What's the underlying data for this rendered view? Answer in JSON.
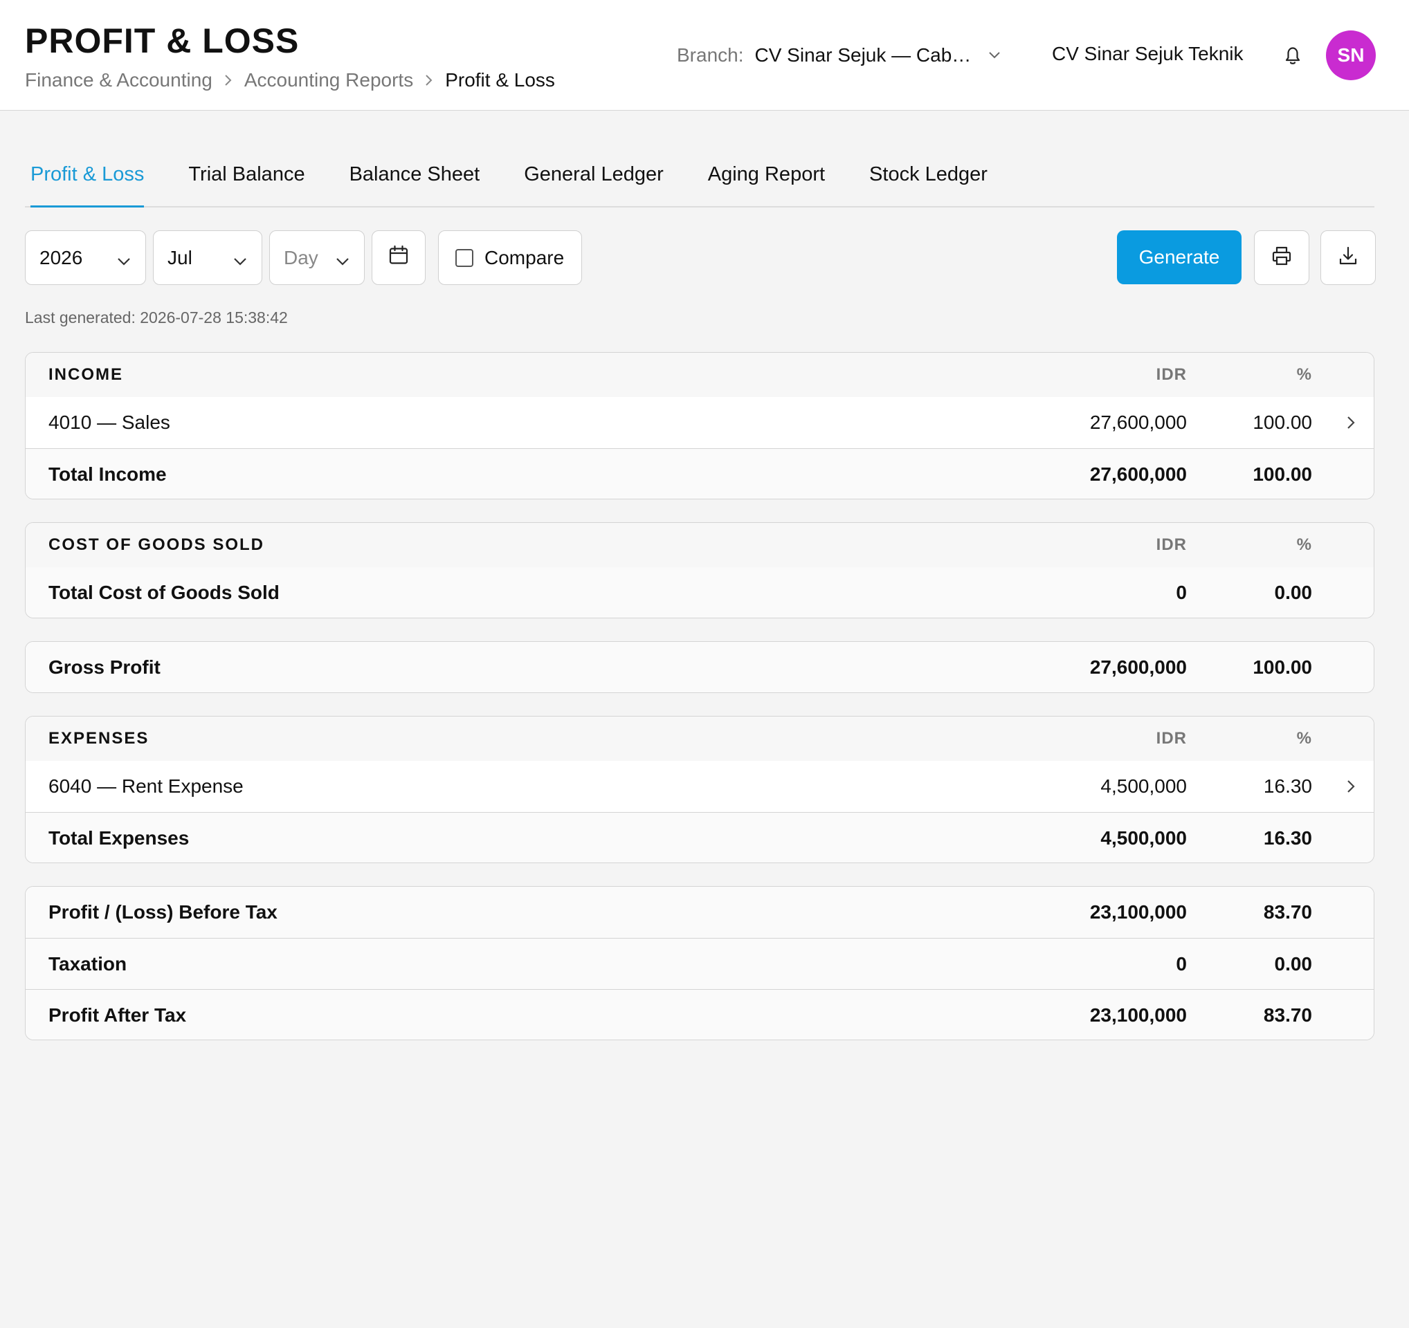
{
  "header": {
    "title": "PROFIT & LOSS",
    "breadcrumb": [
      "Finance & Accounting",
      "Accounting Reports",
      "Profit & Loss"
    ],
    "branch_label": "Branch:",
    "branch_value": "CV Sinar Sejuk — Cab…",
    "company": "CV Sinar Sejuk Teknik",
    "avatar_initials": "SN",
    "avatar_color": "#c92bd0"
  },
  "tabs": [
    "Profit & Loss",
    "Trial Balance",
    "Balance Sheet",
    "General Ledger",
    "Aging Report",
    "Stock Ledger"
  ],
  "active_tab": "Profit & Loss",
  "filters": {
    "year": "2026",
    "month": "Jul",
    "day_placeholder": "Day",
    "compare_label": "Compare",
    "compare_checked": false,
    "generate_label": "Generate"
  },
  "last_generated": "Last generated: 2026-07-28 15:38:42",
  "columns": {
    "amount": "IDR",
    "percent": "%"
  },
  "income": {
    "heading": "INCOME",
    "rows": [
      {
        "name": "4010 — Sales",
        "amount": "27,600,000",
        "percent": "100.00"
      }
    ],
    "total": {
      "name": "Total Income",
      "amount": "27,600,000",
      "percent": "100.00"
    }
  },
  "cogs": {
    "heading": "COST OF GOODS SOLD",
    "total": {
      "name": "Total Cost of Goods Sold",
      "amount": "0",
      "percent": "0.00"
    }
  },
  "gross_profit": {
    "name": "Gross Profit",
    "amount": "27,600,000",
    "percent": "100.00"
  },
  "expenses": {
    "heading": "EXPENSES",
    "rows": [
      {
        "name": "6040 — Rent Expense",
        "amount": "4,500,000",
        "percent": "16.30"
      }
    ],
    "total": {
      "name": "Total Expenses",
      "amount": "4,500,000",
      "percent": "16.30"
    }
  },
  "summary": [
    {
      "name": "Profit / (Loss) Before Tax",
      "amount": "23,100,000",
      "percent": "83.70"
    },
    {
      "name": "Taxation",
      "amount": "0",
      "percent": "0.00"
    },
    {
      "name": "Profit After Tax",
      "amount": "23,100,000",
      "percent": "83.70"
    }
  ],
  "colors": {
    "accent": "#0a9be0",
    "tab_active": "#1a9ad6"
  }
}
